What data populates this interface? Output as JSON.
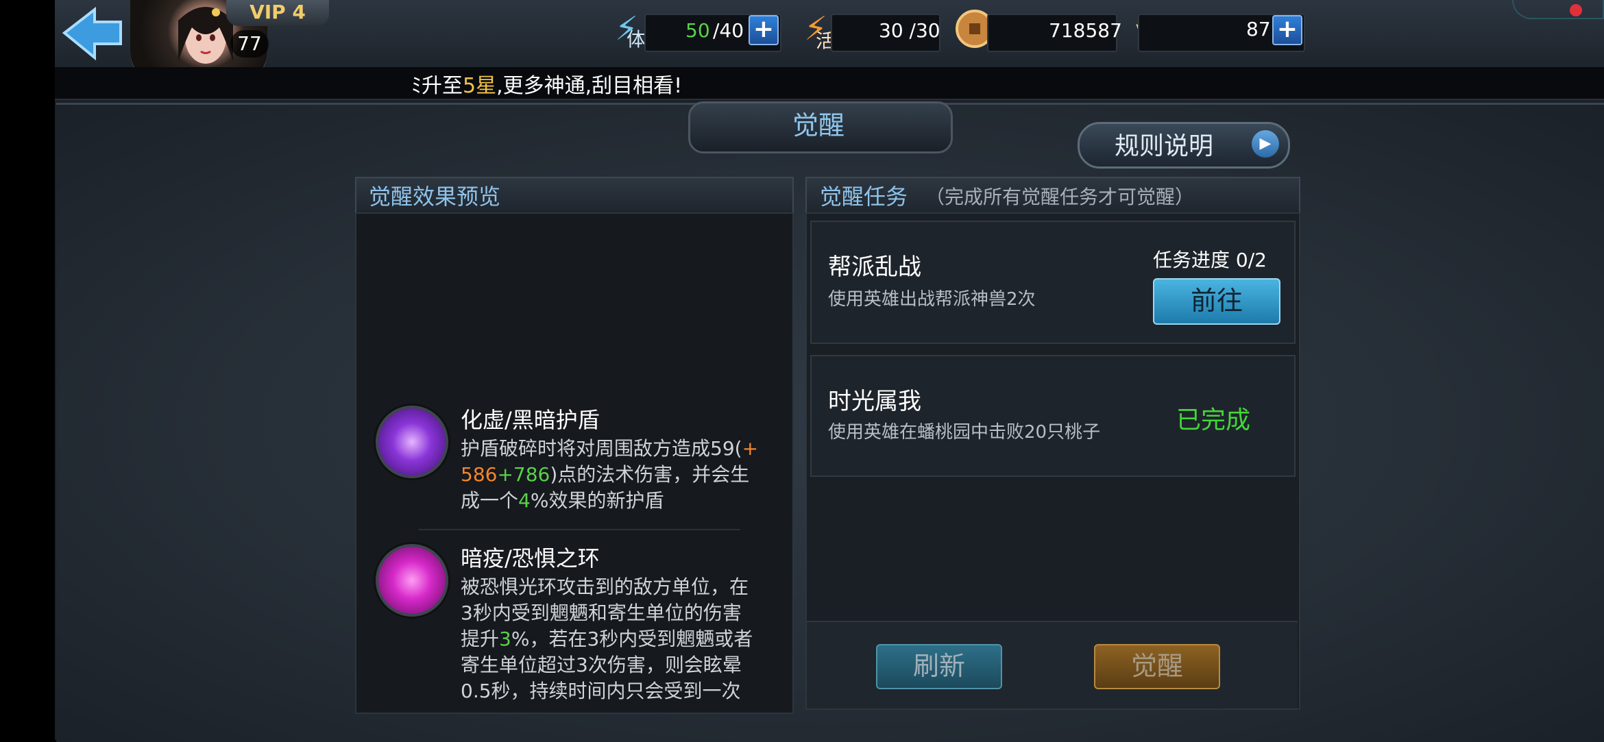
{
  "header": {
    "vip_label": "VIP 4",
    "player_level": "77",
    "stamina": {
      "icon_label": "体",
      "current": "50",
      "max": "/40"
    },
    "energy": {
      "icon_label": "活",
      "value": "30 /30"
    },
    "coins": {
      "value": "718587"
    },
    "gold": {
      "value": "87"
    },
    "ticker": {
      "part1": "ﾐ升至",
      "highlight": "5星",
      "part2": ",更多神通,刮目相看!"
    }
  },
  "page": {
    "title": "觉醒",
    "rules_button": "规则说明"
  },
  "preview": {
    "header": "觉醒效果预览",
    "skills": [
      {
        "name": "化虚/黑暗护盾",
        "desc_a": "护盾破碎时将对周围敌方造成59(",
        "desc_orange1": "+",
        "desc_orange2": "586",
        "desc_green1": "+786",
        "desc_b": ")点的法术伤害，并会生",
        "desc_c": "成一个",
        "desc_green2": "4",
        "desc_d": "%效果的新护盾"
      },
      {
        "name": "暗疫/恐惧之环",
        "desc_a": "被恐惧光环攻击到的敌方单位，在",
        "desc_b": "3秒内受到魍魉和寄生单位的伤害",
        "desc_c": "提升",
        "desc_green": "3",
        "desc_d": "%，若在3秒内受到魍魉或者",
        "desc_e": "寄生单位超过3次伤害，则会眩晕",
        "desc_f": "0.5秒，持续时间内只会受到一次"
      }
    ]
  },
  "tasks": {
    "header": "觉醒任务",
    "subheader": "（完成所有觉醒任务才可觉醒）",
    "items": [
      {
        "name": "帮派乱战",
        "desc": "使用英雄出战帮派神兽2次",
        "progress": "任务进度 0/2",
        "action": "前往"
      },
      {
        "name": "时光属我",
        "desc": "使用英雄在蟠桃园中击败20只桃子",
        "status": "已完成"
      }
    ],
    "refresh_button": "刷新",
    "awaken_button": "觉醒"
  }
}
